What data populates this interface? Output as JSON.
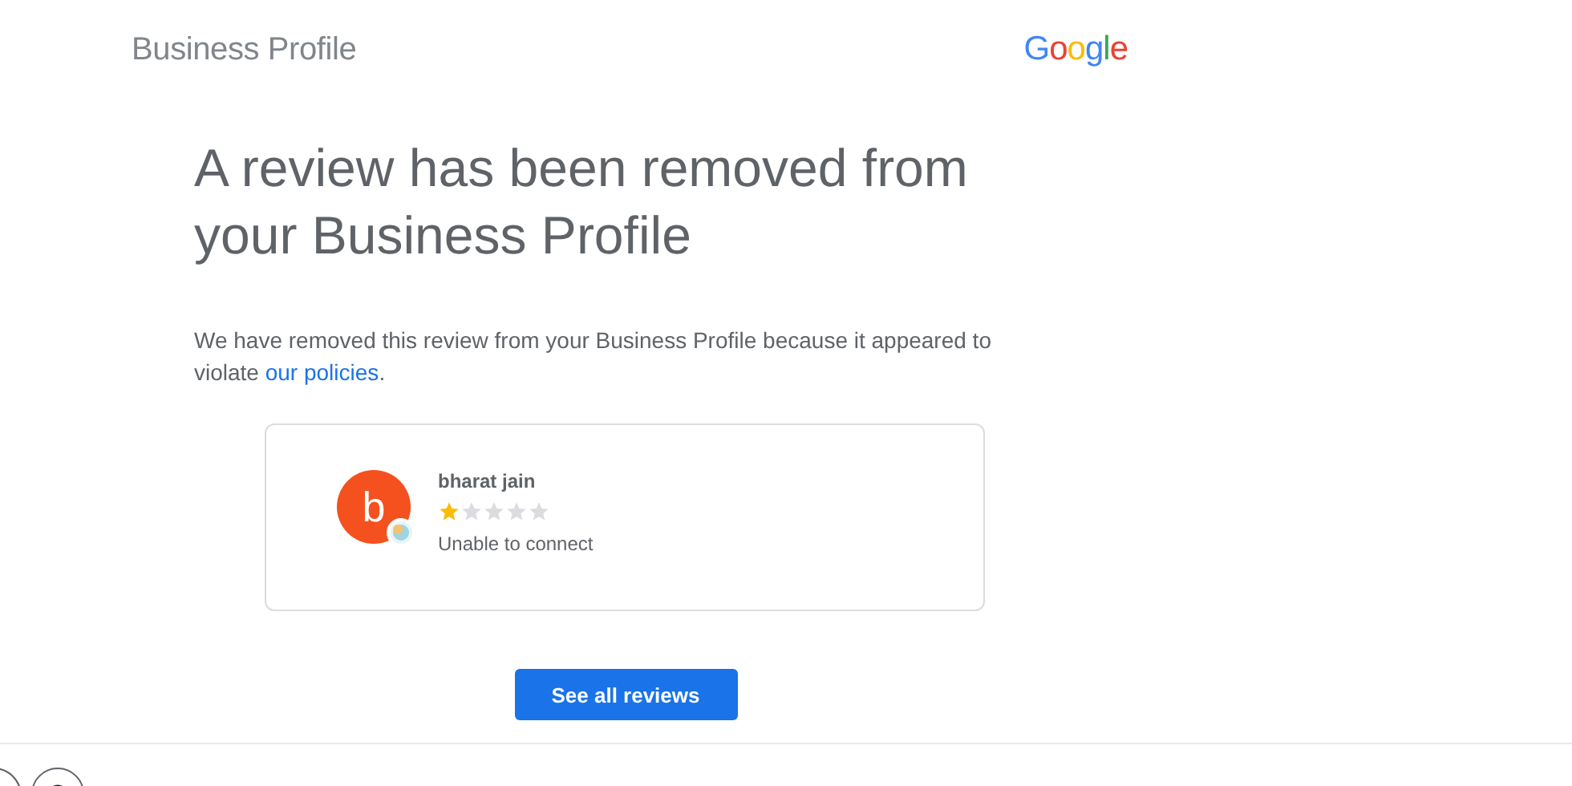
{
  "header": {
    "title": "Business Profile",
    "logo": "Google"
  },
  "heading": "A review has been removed from your Business Profile",
  "message": {
    "text": "We have removed this review from your Business Profile because it appeared to violate ",
    "link": "our policies",
    "end": "."
  },
  "review": {
    "avatar_letter": "b",
    "name": "bharat jain",
    "stars": 1,
    "text": "Unable to connect"
  },
  "button": "See all reviews"
}
